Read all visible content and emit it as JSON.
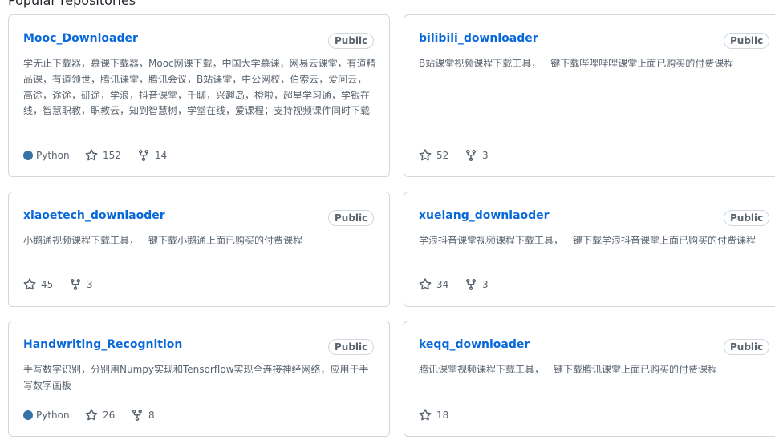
{
  "section": {
    "title": "Popular repositories"
  },
  "colors": {
    "link": "#0969da",
    "muted": "#59636e",
    "border": "#d0d7de",
    "python": "#3572A5"
  },
  "icons": {
    "star": "star-icon",
    "fork": "repo-forked-icon"
  },
  "repos": [
    {
      "name": "Mooc_Downloader",
      "visibility": "Public",
      "description": "学无止下载器，慕课下载器，Mooc网课下载，中国大学慕课，网易云课堂，有道精品课，有道领世，腾讯课堂，腾讯会议，B站课堂，中公网校，伯索云，爱问云，高途，途途，研途，学浪，抖音课堂，千聊，兴趣岛，橙啦，超星学习通，学银在线，智慧职教，职教云，知到智慧树，学堂在线，爱课程；支持视频课件同时下载",
      "language": "Python",
      "stars": "152",
      "forks": "14"
    },
    {
      "name": "bilibili_downloader",
      "visibility": "Public",
      "description": "B站课堂视频课程下载工具，一键下载哔哩哔哩课堂上面已购买的付费课程",
      "stars": "52",
      "forks": "3"
    },
    {
      "name": "xiaoetech_downlaoder",
      "visibility": "Public",
      "description": "小鹅通视频课程下载工具，一键下载小鹅通上面已购买的付费课程",
      "stars": "45",
      "forks": "3"
    },
    {
      "name": "xuelang_downlaoder",
      "visibility": "Public",
      "description": "学浪抖音课堂视频课程下载工具，一键下载学浪抖音课堂上面已购买的付费课程",
      "stars": "34",
      "forks": "3"
    },
    {
      "name": "Handwriting_Recognition",
      "visibility": "Public",
      "description": "手写数字识别，分别用Numpy实现和Tensorflow实现全连接神经网络，应用于手写数字画板",
      "language": "Python",
      "stars": "26",
      "forks": "8"
    },
    {
      "name": "keqq_downloader",
      "visibility": "Public",
      "description": "腾讯课堂视频课程下载工具，一键下载腾讯课堂上面已购买的付费课程",
      "stars": "18"
    }
  ]
}
